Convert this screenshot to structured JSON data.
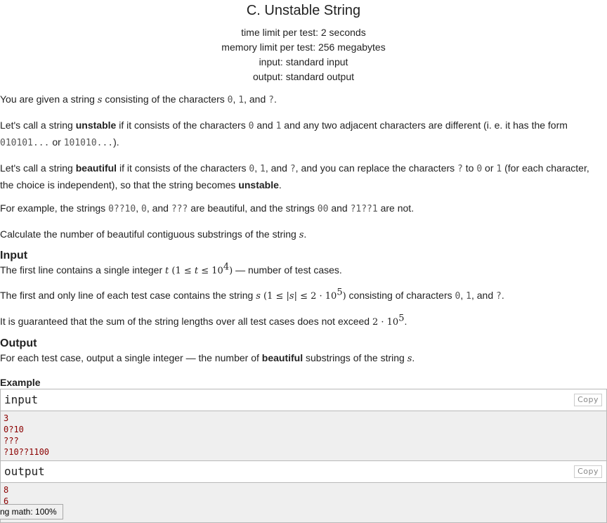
{
  "problem": {
    "title": "C. Unstable String",
    "time_limit": "time limit per test: 2 seconds",
    "memory_limit": "memory limit per test: 256 megabytes",
    "input_spec": "input: standard input",
    "output_spec": "output: standard output"
  },
  "statement": {
    "p1": {
      "a": "You are given a string ",
      "s": "s",
      "b": " consisting of the characters ",
      "c0": "0",
      "comma1": ", ",
      "c1": "1",
      "and": ", and ",
      "cq": "?",
      "end": "."
    },
    "p2": {
      "a": "Let's call a string ",
      "bold": "unstable",
      "b": " if it consists of the characters ",
      "c0": "0",
      "and": " and ",
      "c1": "1",
      "c": " and any two adjacent characters are different (i. e. it has the form ",
      "f1": "010101...",
      "or": " or ",
      "f2": "101010...",
      "end": ")."
    },
    "p3": {
      "a": "Let's call a string ",
      "bold": "beautiful",
      "b": " if it consists of the characters ",
      "c0": "0",
      "comma1": ", ",
      "c1": "1",
      "and": ", and ",
      "cq": "?",
      "c": ", and you can replace the characters ",
      "cq2": "?",
      "to": " to ",
      "c0b": "0",
      "or": " or ",
      "c1b": "1",
      "d": " (for each character, the choice is independent), so that the string becomes ",
      "bold2": "unstable",
      "end": "."
    },
    "p4": {
      "a": "For example, the strings ",
      "e1": "0??10",
      "comma1": ", ",
      "e2": "0",
      "and1": ", and ",
      "e3": "???",
      "b": " are beautiful, and the strings ",
      "e4": "00",
      "and2": " and ",
      "e5": "?1??1",
      "end": " are not."
    },
    "p5": {
      "a": "Calculate the number of beautiful contiguous substrings of the string ",
      "s": "s",
      "end": "."
    }
  },
  "input_section": {
    "title": "Input",
    "l1": {
      "a": "The first line contains a single integer ",
      "t": "t",
      "cond_open": " (1 ≤ ",
      "t2": "t",
      "cond_mid": " ≤ 10",
      "exp": "4",
      "cond_close": ")",
      "b": " — number of test cases."
    },
    "l2": {
      "a": "The first and only line of each test case contains the string ",
      "s": "s",
      "cond_open": " (1 ≤ |",
      "s2": "s",
      "cond_mid": "| ≤ 2 · 10",
      "exp": "5",
      "cond_close": ")",
      "b": " consisting of characters ",
      "c0": "0",
      "comma1": ", ",
      "c1": "1",
      "and": ", and ",
      "cq": "?",
      "end": "."
    },
    "l3": {
      "a": "It is guaranteed that the sum of the string lengths over all test cases does not exceed ",
      "val": "2 · 10",
      "exp": "5",
      "end": "."
    }
  },
  "output_section": {
    "title": "Output",
    "l1": {
      "a": "For each test case, output a single integer — the number of ",
      "bold": "beautiful",
      "b": " substrings of the string ",
      "s": "s",
      "end": "."
    }
  },
  "example": {
    "title": "Example",
    "input_label": "input",
    "output_label": "output",
    "copy_label": "Copy",
    "input_lines": [
      "3",
      "0?10",
      "???",
      "?10??1100"
    ],
    "output_lines": [
      "8",
      "6"
    ]
  },
  "status_bar": {
    "text": "ng math: 100%"
  }
}
